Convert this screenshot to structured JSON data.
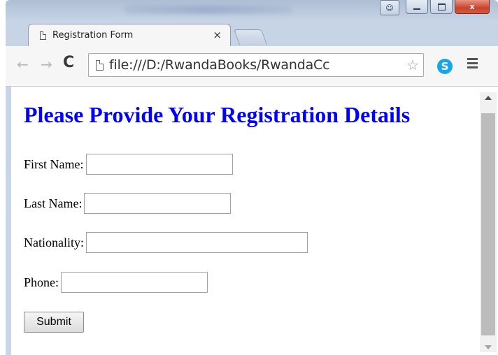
{
  "browser": {
    "tab_title": "Registration Form",
    "tab_close": "×",
    "url": "file:///D:/RwandaBooks/RwandaCc",
    "nav": {
      "back": "←",
      "forward": "→",
      "reload": "C"
    },
    "star_icon": "☆",
    "skype_letter": "S",
    "window_close": "x"
  },
  "page": {
    "heading": "Please Provide Your Registration Details",
    "fields": [
      {
        "label": "First Name:",
        "value": ""
      },
      {
        "label": "Last Name:",
        "value": ""
      },
      {
        "label": "Nationality:",
        "value": ""
      },
      {
        "label": "Phone:",
        "value": ""
      }
    ],
    "submit_label": "Submit"
  },
  "colors": {
    "heading": "#0000ff",
    "skype": "#16a6ea",
    "close_button": "#c7432a"
  }
}
